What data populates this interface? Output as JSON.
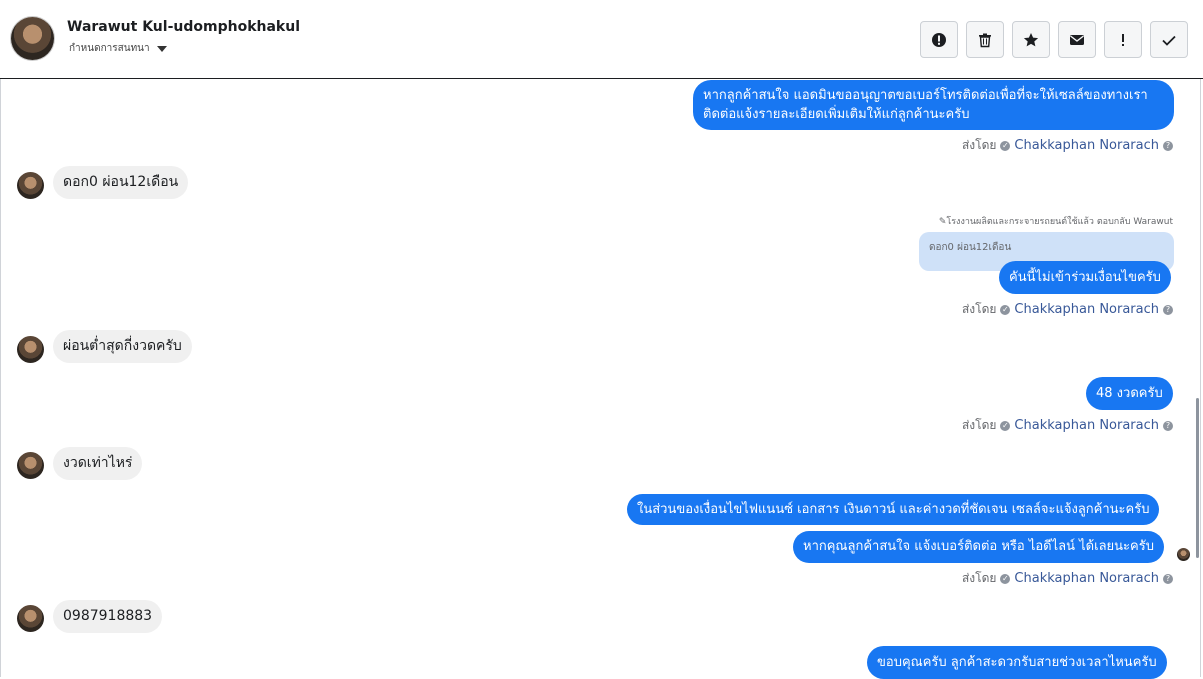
{
  "header": {
    "contact_name": "Warawut Kul-udomphokhakul",
    "subtitle": "กำหนดการสนทนา"
  },
  "toolbar": {
    "icons": [
      "alert-circle-icon",
      "trash-icon",
      "star-icon",
      "envelope-icon",
      "exclamation-icon",
      "check-icon"
    ]
  },
  "messages": {
    "out_1_line1": "หากลูกค้าสนใจ แอดมินขออนุญาตขอเบอร์โทรติดต่อเพื่อที่จะให้เซลล์ของทางเรา",
    "out_1_line2": "ติดต่อแจ้งรายละเอียดเพิ่มเติมให้แก่ลูกค้านะครับ",
    "in_1": "ดอก0  ผ่อน12เดือน",
    "reply_note": "โรงงานผลิตและกระจายรถยนต์ใช้แล้ว ตอบกลับ Warawut",
    "reply_quote": "ดอก0 ผ่อน12เดือน",
    "out_2": "คันนี้ไม่เข้าร่วมเงื่อนไขครับ",
    "in_2": "ผ่อนต่ำสุดกี่งวดครับ",
    "out_3": "48 งวดครับ",
    "in_3": "งวดเท่าไหร่",
    "out_4": "ในส่วนของเงื่อนไขไฟแนนซ์ เอกสาร เงินดาวน์ และค่างวดที่ชัดเจน เซลล์จะแจ้งลูกค้านะครับ",
    "out_5": "หากคุณลูกค้าสนใจ แจ้งเบอร์ติดต่อ หรือ ไอดีไลน์ ได้เลยนะครับ",
    "in_4": "0987918883",
    "out_6": "ขอบคุณครับ ลูกค้าสะดวกรับสายช่วงเวลาไหนครับ"
  },
  "sent_by": {
    "label": "ส่งโดย",
    "name": "Chakkaphan Norarach"
  },
  "colors": {
    "outgoing_bubble": "#1877f2",
    "incoming_bubble": "#f0f0f0",
    "sender_link": "#385898"
  }
}
